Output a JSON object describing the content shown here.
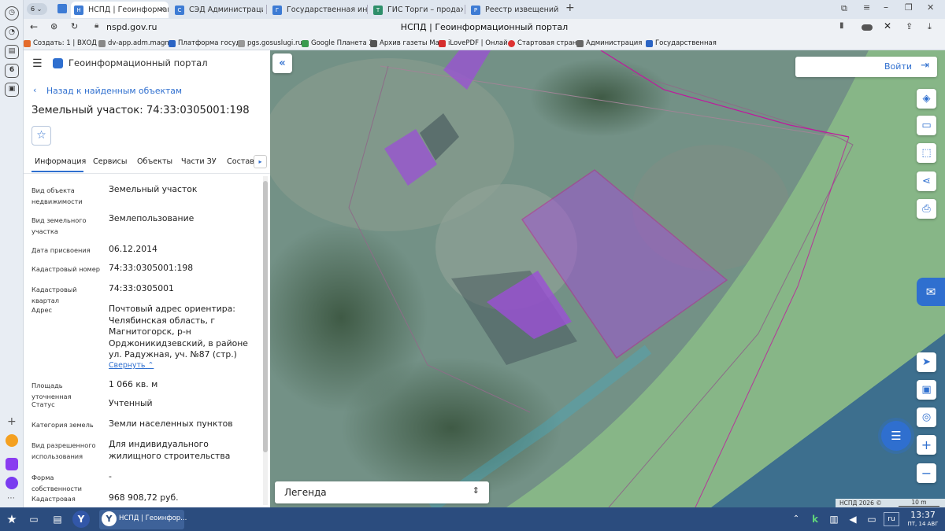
{
  "browser": {
    "tab_count": "6",
    "tabs": [
      {
        "label": "НСПД | Геоинформац"
      },
      {
        "label": "СЭД Администрации Ма"
      },
      {
        "label": "Государственная инфор"
      },
      {
        "label": "ГИС Торги – продажи гос"
      },
      {
        "label": "Реестр извещений"
      }
    ],
    "url": "nspd.gov.ru",
    "page_title": "НСПД | Геоинформационный портал",
    "bookmarks": [
      "Создать: 1 | ВХОД",
      "dv-app.adm.magn",
      "Платформа госуд",
      "pgs.gosuslugi.ru",
      "Google Планета З",
      "Архив газеты Ма",
      "iLovePDF | Онлай",
      "Стартовая стран",
      "Администрация",
      "Государственная"
    ]
  },
  "panel": {
    "brand": "Геоинформационный портал",
    "back_link": "Назад к найденным объектам",
    "title": "Земельный участок: 74:33:0305001:198",
    "tabs": [
      "Информация",
      "Сервисы",
      "Объекты",
      "Части ЗУ",
      "Состав"
    ],
    "fields": [
      {
        "label": "Вид объекта недвижимости",
        "value": "Земельный участок"
      },
      {
        "label": "Вид земельного участка",
        "value": "Землепользование"
      },
      {
        "label": "Дата присвоения",
        "value": "06.12.2014"
      },
      {
        "label": "Кадастровый номер",
        "value": "74:33:0305001:198"
      },
      {
        "label": "Кадастровый квартал",
        "value": "74:33:0305001"
      },
      {
        "label": "Адрес",
        "value": "Почтовый адрес ориентира: Челябинская область, г Магнитогорск, р-н Орджоникидзевский, в районе ул. Радужная, уч. №87 (стр.)"
      },
      {
        "label": "Площадь уточненная",
        "value": "1 066 кв. м"
      },
      {
        "label": "Статус",
        "value": "Учтенный"
      },
      {
        "label": "Категория земель",
        "value": "Земли населенных пунктов"
      },
      {
        "label": "Вид разрешенного использования",
        "value": "Для индивидуального жилищного строительства"
      },
      {
        "label": "Форма собственности",
        "value": "-"
      },
      {
        "label": "Кадастровая",
        "value": "968 908,72 руб."
      }
    ],
    "collapse_link": "Свернуть"
  },
  "map": {
    "login": "Войти",
    "legend": "Легенда",
    "copyright": "НСПД 2026 ©",
    "scale": "10 m"
  },
  "taskbar": {
    "app_label": "НСПД | Геоинфор...",
    "lang": "ru",
    "time": "13:37",
    "date": "ПТ, 14 АВГ"
  },
  "colors": {
    "accent": "#2f6fcf",
    "parcel_fill": "#9b4fd6",
    "parcel_border": "#c0179e",
    "taskbar": "#2b4c7e"
  }
}
